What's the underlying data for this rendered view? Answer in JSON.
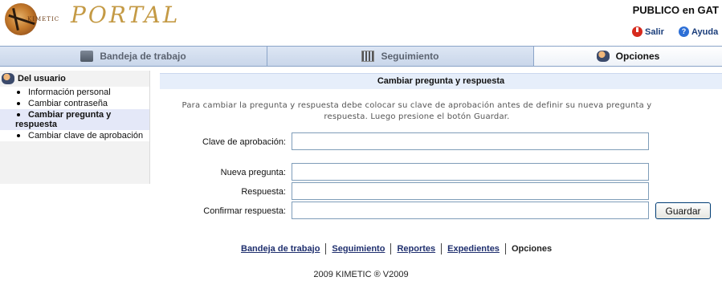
{
  "header": {
    "logo_brand": "KIMETIC",
    "logo_title": "PORTAL",
    "user_area": "PUBLICO en GAT",
    "salir_label": "Salir",
    "ayuda_label": "Ayuda",
    "ayuda_icon": "?"
  },
  "tabs": [
    {
      "label": "Bandeja de trabajo",
      "icon": "inbox-icon"
    },
    {
      "label": "Seguimiento",
      "icon": "tracking-icon"
    },
    {
      "label": "Opciones",
      "icon": "options-icon",
      "active": true
    }
  ],
  "sidebar": {
    "heading": "Del usuario",
    "items": [
      {
        "label": "Información personal"
      },
      {
        "label": "Cambiar contraseña"
      },
      {
        "label": "Cambiar pregunta y respuesta",
        "active": true
      },
      {
        "label": "Cambiar clave de aprobación"
      }
    ]
  },
  "main": {
    "title": "Cambiar pregunta y respuesta",
    "instructions": "Para cambiar la pregunta y respuesta debe colocar su clave de aprobación antes de definir su nueva pregunta y respuesta. Luego presione el botón Guardar.",
    "fields": {
      "clave": {
        "label": "Clave de aprobación:",
        "value": ""
      },
      "pregunta": {
        "label": "Nueva pregunta:",
        "value": ""
      },
      "respuesta": {
        "label": "Respuesta:",
        "value": ""
      },
      "confirmar": {
        "label": "Confirmar respuesta:",
        "value": ""
      }
    },
    "save_label": "Guardar"
  },
  "footer": {
    "links": [
      "Bandeja de trabajo",
      "Seguimiento",
      "Reportes",
      "Expedientes"
    ],
    "current": "Opciones",
    "copyright": "2009 KIMETIC ®  V2009"
  },
  "colors": {
    "accent": "#1f2f6e",
    "panel_title_bg": "#e6eefa",
    "logo_gold": "#c49a45"
  }
}
